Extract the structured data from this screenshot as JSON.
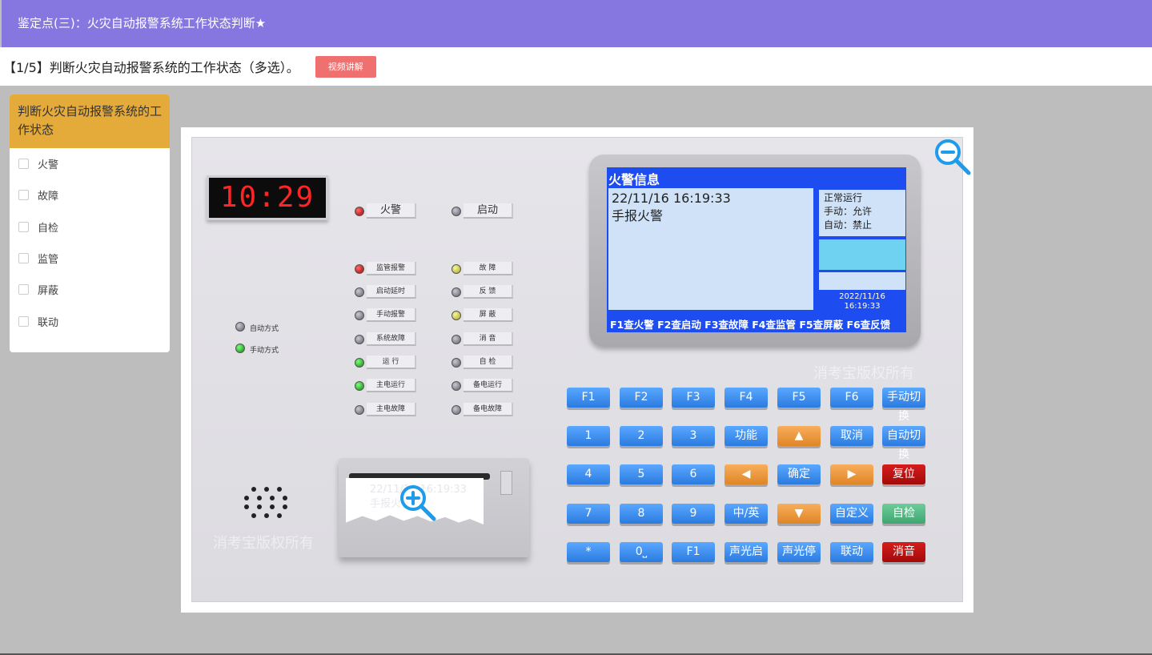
{
  "header": {
    "title": "鉴定点(三)：火灾自动报警系统工作状态判断★"
  },
  "question": {
    "text": "【1/5】判断火灾自动报警系统的工作状态（多选）。",
    "video_button": "视频讲解"
  },
  "options_panel": {
    "title": "判断火灾自动报警系统的工作状态",
    "options": [
      "火警",
      "故障",
      "自检",
      "监管",
      "屏蔽",
      "联动"
    ]
  },
  "panel": {
    "clock": "10:29",
    "big_indicators": [
      "火警",
      "启动"
    ],
    "left_indicators": [
      "监管报警",
      "启动延时",
      "手动报警",
      "系统故障",
      "运 行",
      "主电运行",
      "主电故障"
    ],
    "right_indicators": [
      "故 障",
      "反 馈",
      "屏 蔽",
      "消 音",
      "自 检",
      "备电运行",
      "备电故障"
    ],
    "mode_labels": [
      "自动方式",
      "手动方式"
    ],
    "lcd": {
      "title": "火警信息",
      "line1": "22/11/16 16:19:33",
      "line2": "手报火警",
      "status1": "正常运行",
      "status2": "手动：允许",
      "status3": "自动：禁止",
      "date": "2022/11/16",
      "time": "16:19:33",
      "fkeys": "F1查火警 F2查启动 F3查故障 F4查监管  F5查屏蔽  F6查反馈"
    },
    "keys": [
      [
        "F1",
        "F2",
        "F3",
        "F4",
        "F5",
        "F6",
        "手动切换"
      ],
      [
        "1",
        "2",
        "3",
        "功能",
        "▲",
        "取消",
        "自动切换"
      ],
      [
        "4",
        "5",
        "6",
        "◀",
        "确定",
        "▶",
        "复位"
      ],
      [
        "7",
        "8",
        "9",
        "中/英",
        "▼",
        "自定义",
        "自检"
      ],
      [
        "*",
        "0⎵",
        "F1",
        "声光启",
        "声光停",
        "联动",
        "消音"
      ]
    ],
    "printer_text": [
      "22/11/16 16:19:33",
      "手报火警"
    ],
    "watermark": "消考宝版权所有"
  },
  "colors": {
    "header": "#8677e0",
    "options_head": "#e4aa3a",
    "video_button": "#f07070",
    "lcd": "#1d4cf0"
  }
}
